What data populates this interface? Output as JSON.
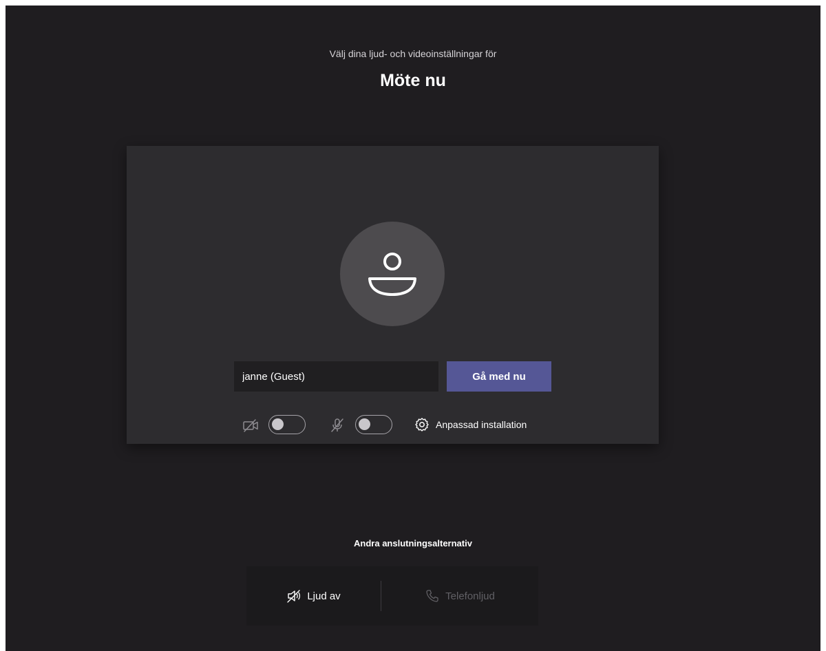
{
  "header": {
    "subtitle": "Välj dina ljud- och videoinställningar för",
    "meeting_title": "Möte nu"
  },
  "prejoin": {
    "name_value": "janne (Guest)",
    "join_label": "Gå med nu",
    "camera_on": false,
    "mic_on": false,
    "settings_label": "Anpassad installation"
  },
  "other_options": {
    "title": "Andra anslutningsalternativ",
    "items": [
      {
        "label": "Ljud av",
        "icon": "speaker-off-icon",
        "enabled": true
      },
      {
        "label": "Telefonljud",
        "icon": "phone-icon",
        "enabled": false
      }
    ]
  },
  "colors": {
    "background": "#1f1d20",
    "card": "#2d2c2f",
    "accent": "#555796",
    "avatar": "#4d4b4e"
  }
}
